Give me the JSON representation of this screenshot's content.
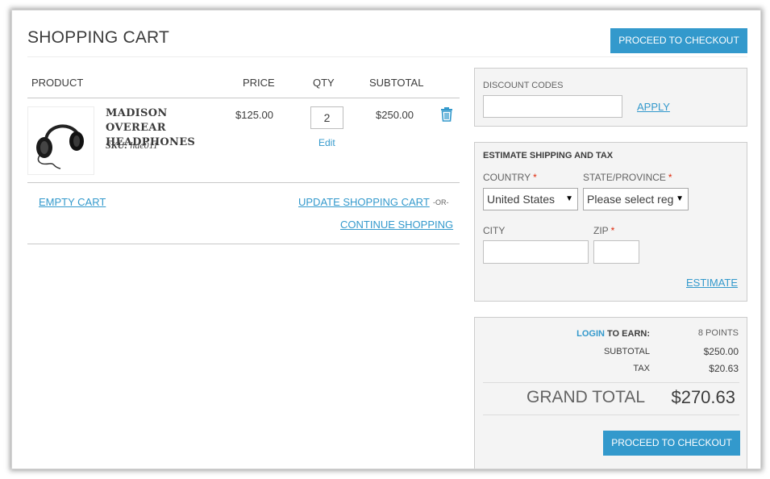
{
  "header": {
    "title": "Shopping Cart",
    "checkout_label": "Proceed to Checkout"
  },
  "table": {
    "columns": [
      "Product",
      "Price",
      "Qty",
      "Subtotal"
    ],
    "item": {
      "name": "Madison Overear Headphones",
      "sku_label": "SKU:",
      "sku": "hde011",
      "price": "$125.00",
      "qty": "2",
      "edit_label": "Edit",
      "subtotal": "$250.00",
      "remove_icon": "trash-icon"
    }
  },
  "actions": {
    "empty_cart": "Empty Cart",
    "update_cart": "Update Shopping Cart",
    "or": "-or-",
    "continue_shopping": "Continue Shopping"
  },
  "discount": {
    "label": "Discount Codes",
    "value": "",
    "apply": "Apply"
  },
  "shipping": {
    "title": "Estimate Shipping and Tax",
    "country_label": "Country",
    "country_value": "United States",
    "state_label": "State/Province",
    "state_value": "Please select reg",
    "city_label": "City",
    "city_value": "",
    "zip_label": "Zip",
    "zip_value": "",
    "estimate": "Estimate"
  },
  "totals": {
    "login_label": "Login",
    "to_earn_label": "to earn:",
    "points": "8 Points",
    "subtotal_label": "Subtotal",
    "subtotal": "$250.00",
    "tax_label": "Tax",
    "tax": "$20.63",
    "grand_total_label": "Grand Total",
    "grand_total": "$270.63",
    "checkout_label": "Proceed to Checkout"
  },
  "colors": {
    "accent": "#3399cc",
    "required": "#df280a",
    "panel_bg": "#f4f4f4"
  }
}
